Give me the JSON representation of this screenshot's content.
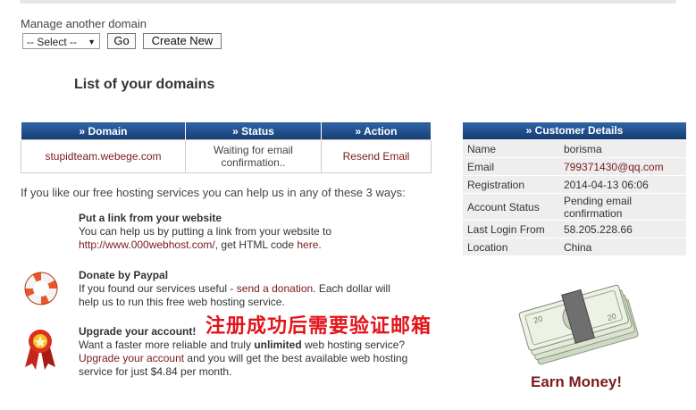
{
  "manage": {
    "label": "Manage another domain",
    "select_value": "-- Select --",
    "go_label": "Go",
    "create_label": "Create New"
  },
  "list_title": "List of your domains",
  "domains_table": {
    "headers": [
      "» Domain",
      "» Status",
      "» Action"
    ],
    "rows": [
      {
        "domain": "stupidteam.webege.com",
        "status": "Waiting for email confirmation..",
        "action": "Resend Email"
      }
    ]
  },
  "ways_text": "If you like our free hosting services you can help us in any of these 3 ways:",
  "help": {
    "link": {
      "title": "Put a link from your website",
      "text1": "You can help us by putting a link from your website to",
      "url": "http://www.000webhost.com/",
      "text2": ", get HTML code ",
      "here": "here",
      "text3": "."
    },
    "paypal": {
      "title": "Donate by Paypal",
      "text1": "If you found our services useful - ",
      "donation": "send a donation",
      "text2": ". Each dollar will help us to run this free web hosting service."
    },
    "upgrade": {
      "title": "Upgrade your account!",
      "text1": "Want a faster more reliable and truly ",
      "unlimited": "unlimited",
      "text2": " web hosting service? ",
      "upgrade_link": "Upgrade your account",
      "text3": " and you will get the best available web hosting service for just $4.84 per month."
    }
  },
  "overlay_text": "注册成功后需要验证邮箱",
  "customer": {
    "header": "» Customer Details",
    "rows": [
      {
        "key": "Name",
        "value": "borisma"
      },
      {
        "key": "Email",
        "value": "799371430@qq.com"
      },
      {
        "key": "Registration",
        "value": "2014-04-13 06:06"
      },
      {
        "key": "Account Status",
        "value": "Pending email confirmation"
      },
      {
        "key": "Last Login From",
        "value": "58.205.228.66"
      },
      {
        "key": "Location",
        "value": "China"
      }
    ]
  },
  "earn_money": "Earn Money!",
  "icons": {
    "donate": "lifebuoy-icon",
    "upgrade": "award-ribbon-icon",
    "money": "money-stack-icon"
  },
  "colors": {
    "header_blue": "#1f4e8c",
    "link_red": "#7a1a1a",
    "overlay_red": "#e3141b"
  }
}
